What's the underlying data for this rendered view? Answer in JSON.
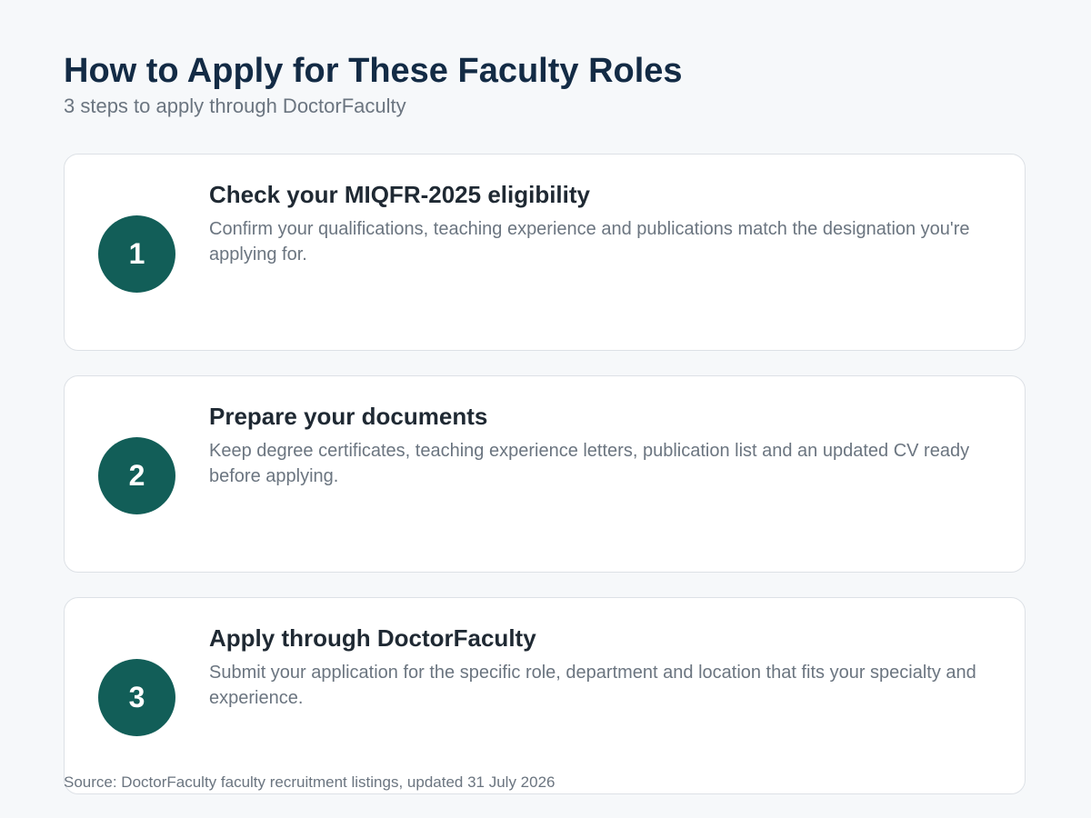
{
  "header": {
    "title": "How to Apply for These Faculty Roles",
    "subtitle": "3 steps to apply through DoctorFaculty"
  },
  "steps": [
    {
      "number": "1",
      "title": "Check your MIQFR-2025 eligibility",
      "description": "Confirm your qualifications, teaching experience and publications match the designation you're applying for."
    },
    {
      "number": "2",
      "title": "Prepare your documents",
      "description": "Keep degree certificates, teaching experience letters, publication list and an updated CV ready before applying."
    },
    {
      "number": "3",
      "title": "Apply through DoctorFaculty",
      "description": "Submit your application for the specific role, department and location that fits your specialty and experience."
    }
  ],
  "footer": {
    "source": "Source: DoctorFaculty faculty recruitment listings, updated 31 July 2026"
  },
  "colors": {
    "background": "#f6f8fa",
    "accent": "#125e58",
    "title": "#132b45",
    "muted_text": "#6b7580"
  }
}
